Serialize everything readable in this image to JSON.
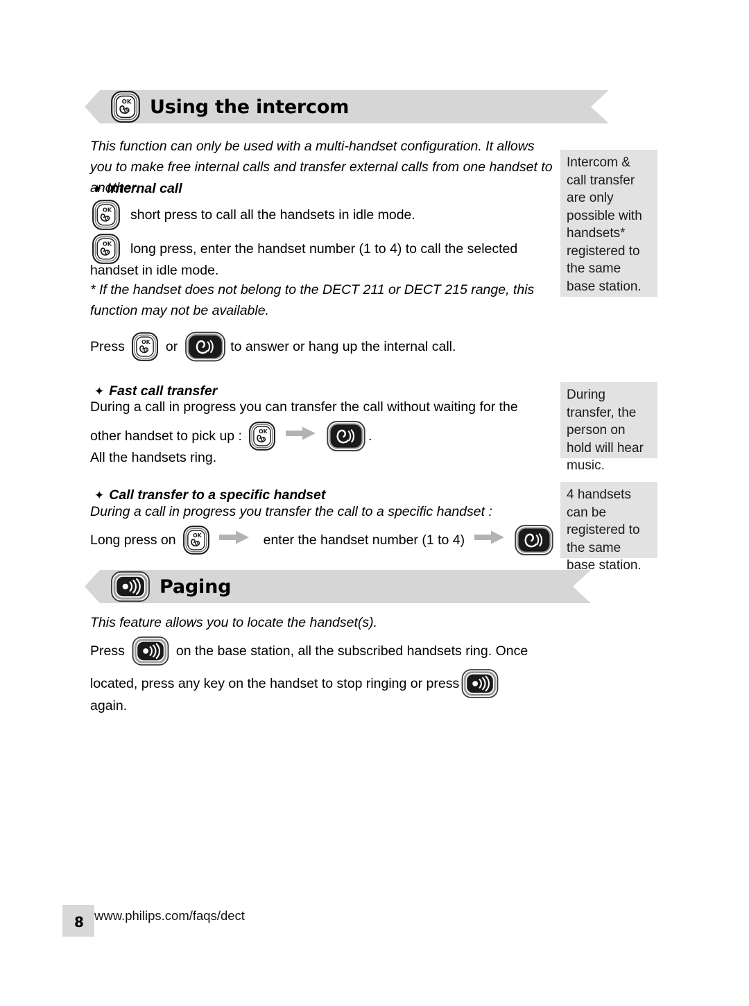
{
  "document": {
    "page_number": "8",
    "footer_url": "www.philips.com/faqs/dect"
  },
  "colors": {
    "banner_gray": "#d6d6d6",
    "note_gray": "#e2e2e2",
    "button_dark": "#1a1a1a",
    "arrow_gray": "#b3b3b3",
    "footer_box_gray": "#d8d8d8"
  },
  "sections": {
    "intercom": {
      "banner": {
        "title": "Using the intercom",
        "icon": "ok-handset-key-icon"
      },
      "intro": "This function can only be used with a multi-handset configuration. It allows you to make free internal calls and transfer external calls from one handset to another.",
      "internal_call": {
        "heading": "Internal call",
        "bullet": "✦",
        "line1": "short press to call all the handsets in idle mode.",
        "line2": "long press, enter the handset number (1 to 4) to call the selected",
        "line2_cont": "handset in idle mode.",
        "footnote": "* If the handset does not belong to the DECT 211 or DECT 215 range, this function may not be available.",
        "press_prefix": "Press",
        "press_or": "or",
        "press_suffix": "to answer or hang up the internal call."
      },
      "fast_call_transfer": {
        "heading": "Fast call transfer",
        "bullet": "✦",
        "line1": "During a call in progress you can transfer the call without waiting for the",
        "line2_prefix": "other handset to pick up :",
        "line2_suffix": ".",
        "line3": "All the handsets ring."
      },
      "call_transfer_specific": {
        "heading": "Call transfer to a specific handset",
        "bullet": "✦",
        "intro": "During a call in progress you transfer the call to a specific handset :",
        "step_prefix": "Long press on",
        "step_middle": "enter the handset number (1 to 4)"
      }
    },
    "paging": {
      "banner": {
        "title": "Paging",
        "icon": "paging-speaker-key-icon"
      },
      "intro": "This feature allows you to locate the handset(s).",
      "press_prefix": "Press",
      "press_suffix": "on the base station, all the subscribed handsets ring. Once",
      "line2_prefix": "located, press any key on the handset to stop ringing or press",
      "line3": "again."
    }
  },
  "notes": [
    {
      "text": "Intercom & call transfer are only possible with handsets* registered to the same base station."
    },
    {
      "text": "During transfer, the person on hold will hear music."
    },
    {
      "text": "4 handsets can be registered to the same base station."
    }
  ]
}
